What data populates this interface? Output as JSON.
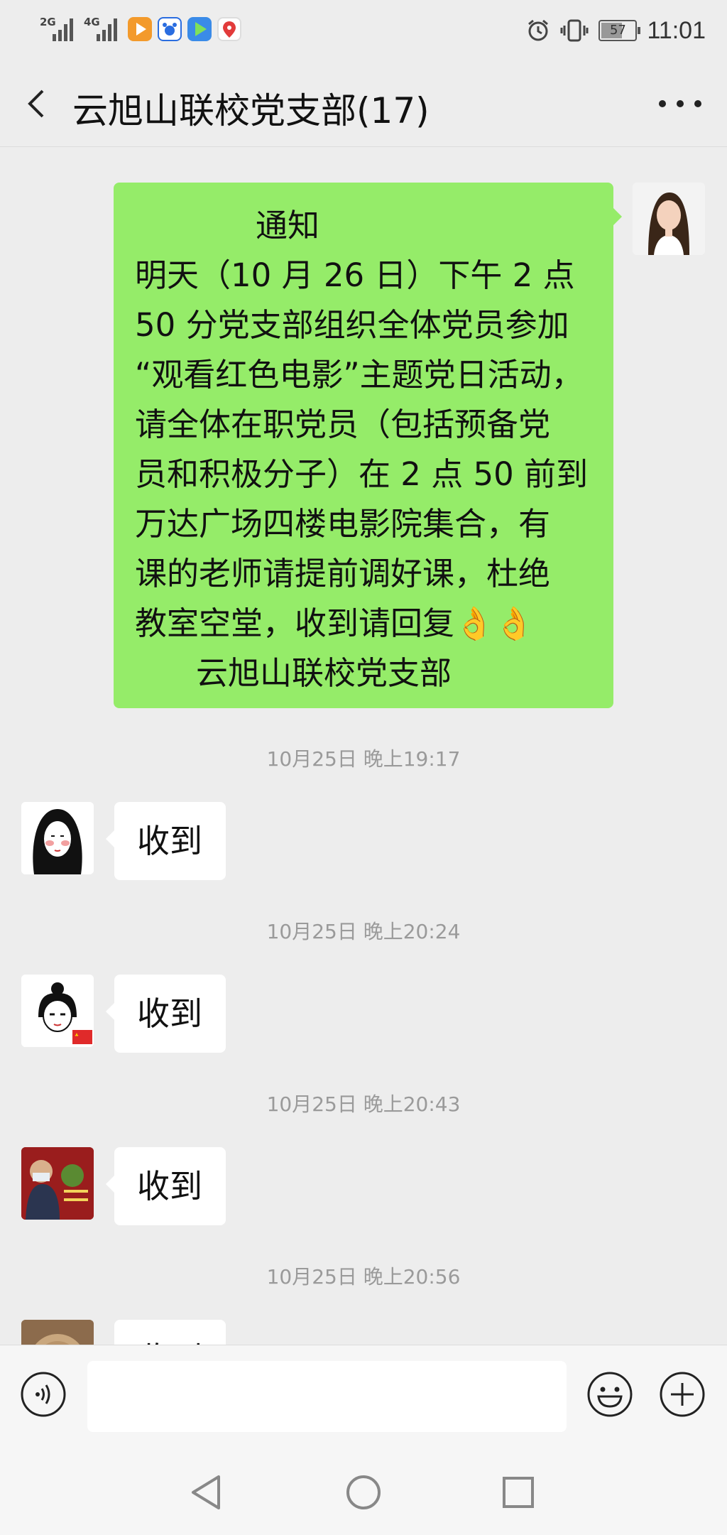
{
  "status_bar": {
    "network_1": "2G",
    "network_2": "4G",
    "battery": "57",
    "time": "11:01"
  },
  "header": {
    "title": "云旭山联校党支部(17)"
  },
  "chat": {
    "notice": {
      "lines": [
        "通知",
        "明天（10 月 26 日）下午 2 点",
        "50 分党支部组织全体党员参加",
        "“观看红色电影”主题党日活动，",
        "请全体在职党员（包括预备党",
        "员和积极分子）在 2 点 50 前到",
        "万达广场四楼电影院集合，有",
        "课的老师请提前调好课，杜绝",
        "教室空堂，收到请回复👌👌",
        "云旭山联校党支部"
      ]
    },
    "messages": [
      {
        "time": "10月25日 晚上19:17",
        "text": "收到"
      },
      {
        "time": "10月25日 晚上20:24",
        "text": "收到"
      },
      {
        "time": "10月25日 晚上20:43",
        "text": "收到"
      },
      {
        "time": "10月25日 晚上20:56",
        "text": "收到"
      }
    ]
  },
  "colors": {
    "background": "#ededed",
    "my_bubble": "#95ec69",
    "other_bubble": "#ffffff",
    "timestamp": "#9a9a9a"
  },
  "icons": [
    "back-arrow-icon",
    "more-icon",
    "voice-icon",
    "emoji-icon",
    "plus-icon",
    "nav-back-icon",
    "nav-home-icon",
    "nav-recent-icon"
  ]
}
